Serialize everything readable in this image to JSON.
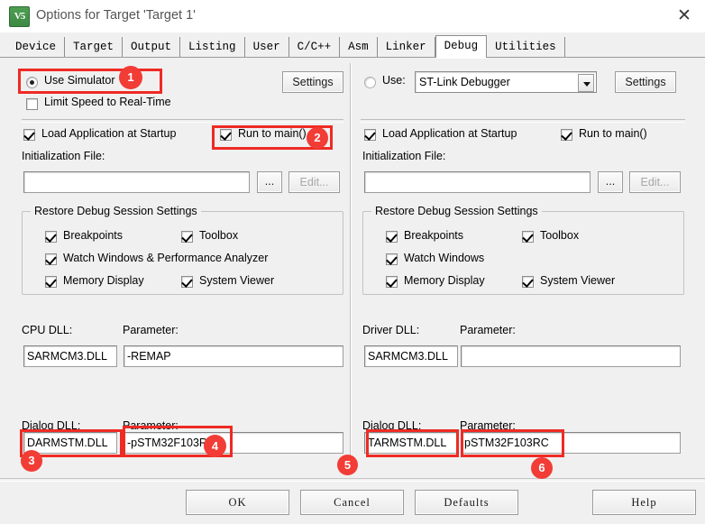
{
  "window": {
    "title": "Options for Target 'Target 1'",
    "icon": "keil-uvision-icon",
    "icon_text": "V5",
    "close_label": "✕"
  },
  "tabs": [
    {
      "label": "Device",
      "selected": false
    },
    {
      "label": "Target",
      "selected": false
    },
    {
      "label": "Output",
      "selected": false
    },
    {
      "label": "Listing",
      "selected": false
    },
    {
      "label": "User",
      "selected": false
    },
    {
      "label": "C/C++",
      "selected": false
    },
    {
      "label": "Asm",
      "selected": false
    },
    {
      "label": "Linker",
      "selected": false
    },
    {
      "label": "Debug",
      "selected": true
    },
    {
      "label": "Utilities",
      "selected": false
    }
  ],
  "left": {
    "use_simulator_label": "Use Simulator",
    "use_simulator_checked": true,
    "limit_speed_label": "Limit Speed to Real-Time",
    "limit_speed_checked": false,
    "settings_label": "Settings",
    "load_app_label": "Load Application at Startup",
    "load_app_checked": true,
    "run_to_main_label": "Run to main()",
    "run_to_main_checked": true,
    "init_file_label": "Initialization File:",
    "init_file_value": "",
    "browse_label": "...",
    "edit_label": "Edit...",
    "edit_disabled": true,
    "group_title": "Restore Debug Session Settings",
    "breakpoints_label": "Breakpoints",
    "breakpoints_checked": true,
    "toolbox_label": "Toolbox",
    "toolbox_checked": true,
    "watch_label": "Watch Windows & Performance Analyzer",
    "watch_checked": true,
    "memory_label": "Memory Display",
    "memory_checked": true,
    "sysview_label": "System Viewer",
    "sysview_checked": true,
    "cpu_dll_label": "CPU DLL:",
    "cpu_dll_value": "SARMCM3.DLL",
    "cpu_param_label": "Parameter:",
    "cpu_param_value": "-REMAP",
    "dialog_dll_label": "Dialog DLL:",
    "dialog_dll_value": "DARMSTM.DLL",
    "dialog_param_label": "Parameter:",
    "dialog_param_value": "-pSTM32F103RC"
  },
  "right": {
    "use_label": "Use:",
    "use_checked": false,
    "debugger_value": "ST-Link Debugger",
    "settings_label": "Settings",
    "load_app_label": "Load Application at Startup",
    "load_app_checked": true,
    "run_to_main_label": "Run to main()",
    "run_to_main_checked": true,
    "init_file_label": "Initialization File:",
    "init_file_value": "",
    "browse_label": "...",
    "edit_label": "Edit...",
    "edit_disabled": true,
    "group_title": "Restore Debug Session Settings",
    "breakpoints_label": "Breakpoints",
    "breakpoints_checked": true,
    "toolbox_label": "Toolbox",
    "toolbox_checked": true,
    "watch_label": "Watch Windows",
    "watch_checked": true,
    "memory_label": "Memory Display",
    "memory_checked": true,
    "sysview_label": "System Viewer",
    "sysview_checked": true,
    "driver_dll_label": "Driver DLL:",
    "driver_dll_value": "SARMCM3.DLL",
    "driver_param_label": "Parameter:",
    "driver_param_value": "",
    "dialog_dll_label": "Dialog DLL:",
    "dialog_dll_value": "TARMSTM.DLL",
    "dialog_param_label": "Parameter:",
    "dialog_param_value": "pSTM32F103RC"
  },
  "footer": {
    "ok_label": "OK",
    "cancel_label": "Cancel",
    "defaults_label": "Defaults",
    "help_label": "Help"
  },
  "annotations": {
    "color": "#ee2b24",
    "badge_color": "#f23c36",
    "markers": [
      {
        "id": "1",
        "target": "use-simulator"
      },
      {
        "id": "2",
        "target": "run-to-main-left"
      },
      {
        "id": "3",
        "target": "dialog-dll-left"
      },
      {
        "id": "4",
        "target": "dialog-parameter-left"
      },
      {
        "id": "5",
        "target": "panel-divider"
      },
      {
        "id": "6",
        "target": "dialog-parameter-right"
      }
    ]
  }
}
